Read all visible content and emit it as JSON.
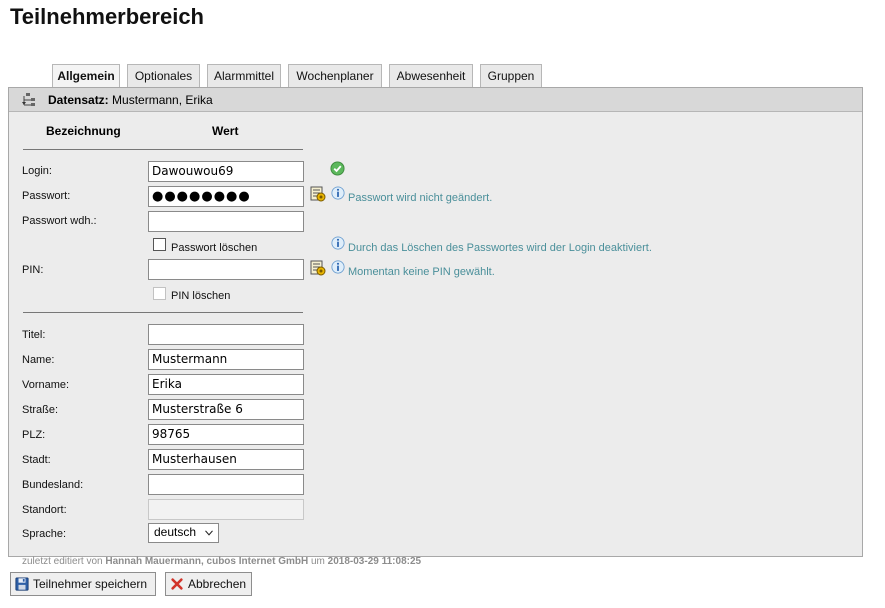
{
  "page_title": "Teilnehmerbereich",
  "tabs": [
    {
      "label": "Allgemein",
      "active": true
    },
    {
      "label": "Optionales",
      "active": false
    },
    {
      "label": "Alarmmittel",
      "active": false
    },
    {
      "label": "Wochenplaner",
      "active": false
    },
    {
      "label": "Abwesenheit",
      "active": false
    },
    {
      "label": "Gruppen",
      "active": false
    }
  ],
  "record": {
    "label": "Datensatz:",
    "name": "Mustermann, Erika"
  },
  "columns": {
    "label": "Bezeichnung",
    "value": "Wert"
  },
  "auth": {
    "login_label": "Login:",
    "login_value": "Dawouwou69",
    "password_label": "Passwort:",
    "password_value": "●●●●●●●●",
    "password_hint": "Passwort wird nicht geändert.",
    "password_repeat_label": "Passwort wdh.:",
    "password_repeat_value": "",
    "delete_password_label": "Passwort löschen",
    "delete_password_hint": "Durch das Löschen des Passwortes wird der Login deaktiviert.",
    "pin_label": "PIN:",
    "pin_value": "",
    "pin_hint": "Momentan keine PIN gewählt.",
    "delete_pin_label": "PIN löschen"
  },
  "person": {
    "title_label": "Titel:",
    "title_value": "",
    "name_label": "Name:",
    "name_value": "Mustermann",
    "firstname_label": "Vorname:",
    "firstname_value": "Erika",
    "street_label": "Straße:",
    "street_value": "Musterstraße 6",
    "zip_label": "PLZ:",
    "zip_value": "98765",
    "city_label": "Stadt:",
    "city_value": "Musterhausen",
    "state_label": "Bundesland:",
    "state_value": "",
    "location_label": "Standort:",
    "location_value": "",
    "language_label": "Sprache:",
    "language_value": "deutsch"
  },
  "footer": {
    "prefix": "zuletzt editiert von",
    "editor": "Hannah Mauermann, cubos Internet GmbH",
    "middle": "um",
    "timestamp": "2018-03-29 11:08:25"
  },
  "buttons": {
    "save": "Teilnehmer speichern",
    "cancel": "Abbrechen"
  },
  "colors": {
    "hint": "#4a8f9a",
    "panel": "#ececec",
    "header": "#d8d8d8"
  }
}
